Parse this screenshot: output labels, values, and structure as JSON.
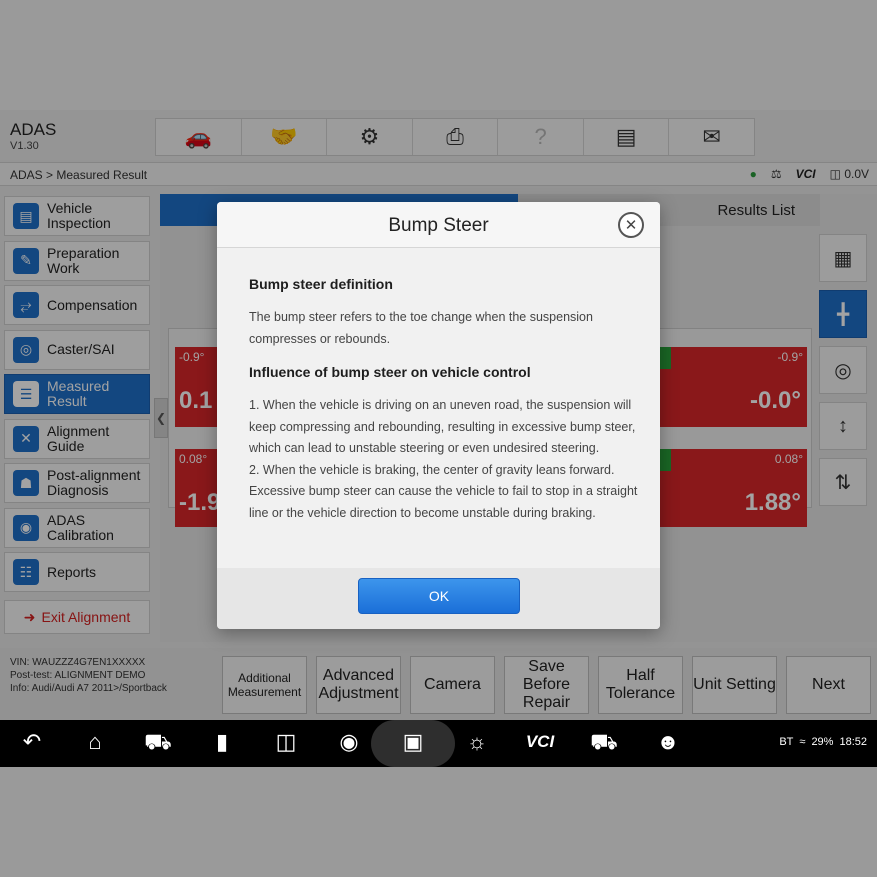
{
  "app": {
    "title": "ADAS",
    "version": "V1.30"
  },
  "toolbar": {
    "icons": [
      "car-diagnose-icon",
      "handshake-icon",
      "gear-icon",
      "printer-icon",
      "help-icon",
      "save-icon",
      "message-icon"
    ]
  },
  "breadcrumb": "ADAS > Measured Result",
  "status": {
    "vci": "VCI",
    "voltage": "0.0V"
  },
  "sidebar": {
    "items": [
      {
        "label": "Vehicle Inspection",
        "icon": "vehicle-inspection-icon",
        "active": false
      },
      {
        "label": "Preparation Work",
        "icon": "preparation-icon",
        "active": false
      },
      {
        "label": "Compensation",
        "icon": "compensation-icon",
        "active": false
      },
      {
        "label": "Caster/SAI",
        "icon": "steering-wheel-icon",
        "active": false
      },
      {
        "label": "Measured Result",
        "icon": "list-icon",
        "active": true
      },
      {
        "label": "Alignment Guide",
        "icon": "wrench-icon",
        "active": false
      },
      {
        "label": "Post-alignment Diagnosis",
        "icon": "car-icon",
        "active": false
      },
      {
        "label": "ADAS Calibration",
        "icon": "adas-icon",
        "active": false
      },
      {
        "label": "Reports",
        "icon": "report-icon",
        "active": false
      }
    ],
    "exit_label": "Exit Alignment"
  },
  "main": {
    "tab_right": "Results List",
    "left_values": {
      "top_small": "-0.9°",
      "top_big": "0.1",
      "bottom_small": "0.08°",
      "bottom_big": "-1.9"
    },
    "right_values": {
      "top_small": "-0.9°",
      "top_big": "-0.0°",
      "bottom_small": "0.08°",
      "bottom_big": "1.88°"
    }
  },
  "vehicle": {
    "vin": "VIN: WAUZZZ4G7EN1XXXXX",
    "post_test": "Post-test: ALIGNMENT DEMO",
    "info": "Info: Audi/Audi A7 2011>/Sportback"
  },
  "actions": [
    {
      "label": "Additional Measurement",
      "name": "additional-measurement-button",
      "small": true
    },
    {
      "label": "Advanced Adjustment",
      "name": "advanced-adjustment-button",
      "small": false
    },
    {
      "label": "Camera",
      "name": "camera-button",
      "small": false
    },
    {
      "label": "Save Before Repair",
      "name": "save-before-repair-button",
      "small": false
    },
    {
      "label": "Half Tolerance",
      "name": "half-tolerance-button",
      "small": false
    },
    {
      "label": "Unit Setting",
      "name": "unit-setting-button",
      "small": false
    },
    {
      "label": "Next",
      "name": "next-button",
      "small": false
    }
  ],
  "system_status": {
    "bt": "BT",
    "battery": "29%",
    "time": "18:52"
  },
  "dialog": {
    "title": "Bump Steer",
    "heading1": "Bump steer definition",
    "para1": "The bump steer refers to the toe change when the suspension compresses or rebounds.",
    "heading2": "Influence of bump steer on vehicle control",
    "para2": "1. When the vehicle is driving on an uneven road, the suspension will keep compressing and rebounding, resulting in excessive bump steer, which can lead to unstable steering or even undesired steering.",
    "para3": "2. When the vehicle is braking, the center of gravity leans forward. Excessive bump steer can cause the vehicle to fail to stop in a straight line or the vehicle direction to become unstable during braking.",
    "ok_label": "OK"
  }
}
